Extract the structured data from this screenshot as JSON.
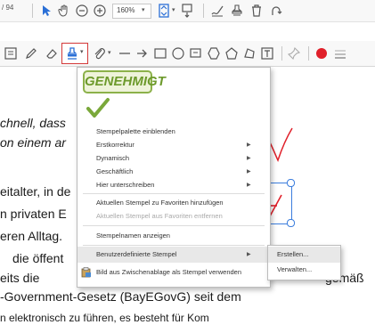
{
  "toolbar_top": {
    "page_indicator": "/ 94",
    "zoom_value": "160%"
  },
  "document": {
    "lines": [
      "chnell, dass",
      "on einem ar",
      "eitalter, in de",
      "n privaten E",
      "eren Alltag.",
      "die öffent",
      "eits die",
      "gemäß",
      "-Government-Gesetz (BayEGovG) seit dem",
      "n elektronisch zu führen, es besteht für Kom"
    ]
  },
  "stamp_menu": {
    "approved_stamp_text": "GENEHMIGT",
    "items": [
      {
        "label": "Stempelpalette einblenden",
        "submenu": false,
        "disabled": false
      },
      {
        "label": "Erstkorrektur",
        "submenu": true,
        "disabled": false
      },
      {
        "label": "Dynamisch",
        "submenu": true,
        "disabled": false
      },
      {
        "label": "Geschäftlich",
        "submenu": true,
        "disabled": false
      },
      {
        "label": "Hier unterschreiben",
        "submenu": true,
        "disabled": false
      },
      {
        "label": "Aktuellen Stempel zu Favoriten hinzufügen",
        "submenu": false,
        "disabled": false
      },
      {
        "label": "Aktuellen Stempel aus Favoriten entfernen",
        "submenu": false,
        "disabled": true
      },
      {
        "label": "Stempelnamen anzeigen",
        "submenu": false,
        "disabled": false
      },
      {
        "label": "Benutzerdefinierte Stempel",
        "submenu": true,
        "disabled": false
      },
      {
        "label": "Bild aus Zwischenablage als Stempel verwenden",
        "submenu": false,
        "disabled": false
      }
    ]
  },
  "custom_stamps_submenu": {
    "items": [
      "Erstellen...",
      "Verwalten..."
    ]
  },
  "colors": {
    "accent_red": "#e0202a",
    "stamp_green": "#6d9a2c",
    "selection_blue": "#3b7ddd"
  }
}
